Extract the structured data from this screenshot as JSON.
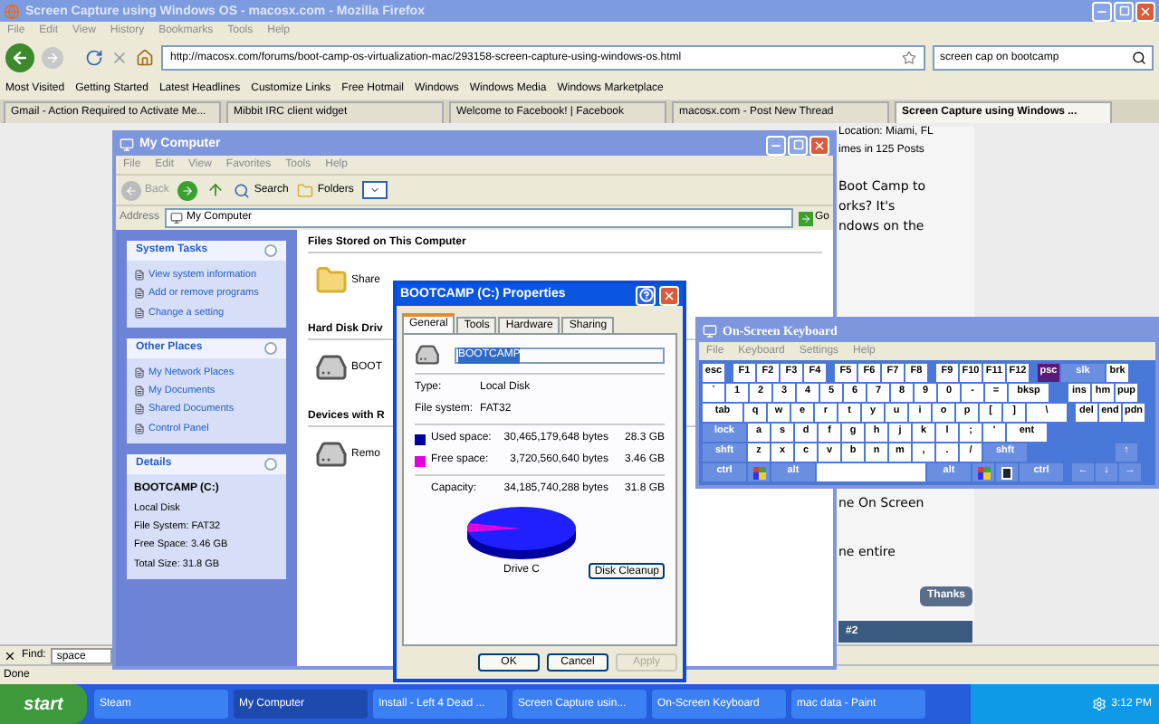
{
  "browser": {
    "title": "Screen Capture using Windows OS - macosx.com - Mozilla Firefox",
    "menu": [
      "File",
      "Edit",
      "View",
      "History",
      "Bookmarks",
      "Tools",
      "Help"
    ],
    "url": "http://macosx.com/forums/boot-camp-os-virtualization-mac/293158-screen-capture-using-windows-os.html",
    "search": "screen cap on bootcamp",
    "bookmarks": [
      "Most Visited",
      "Getting Started",
      "Latest Headlines",
      "Customize Links",
      "Free Hotmail",
      "Windows",
      "Windows Media",
      "Windows Marketplace"
    ],
    "tabs": [
      {
        "label": "Gmail - Action Required to Activate Me...",
        "selected": false
      },
      {
        "label": "Mibbit IRC client widget",
        "selected": false
      },
      {
        "label": "Welcome to Facebook! | Facebook",
        "selected": false
      },
      {
        "label": "macosx.com - Post New Thread",
        "selected": false
      },
      {
        "label": "Screen Capture using Windows ...",
        "selected": true
      }
    ],
    "find_label": "Find:",
    "find_value": "space",
    "status": "Done"
  },
  "page": {
    "lines": [
      "Location: Miami, FL",
      "imes in 125 Posts",
      "Boot Camp to",
      "orks? It's",
      "ndows on the"
    ],
    "lines_lower": [
      "ne On Screen",
      "ne entire"
    ],
    "thanks": "Thanks",
    "post_number": "#2"
  },
  "my_computer": {
    "title": "My Computer",
    "menu": [
      "File",
      "Edit",
      "View",
      "Favorites",
      "Tools",
      "Help"
    ],
    "back": "Back",
    "search": "Search",
    "folders": "Folders",
    "address_label": "Address",
    "address": "My Computer",
    "go": "Go",
    "panels": [
      {
        "title": "System Tasks",
        "items": [
          "View system information",
          "Add or remove programs",
          "Change a setting"
        ]
      },
      {
        "title": "Other Places",
        "items": [
          "My Network Places",
          "My Documents",
          "Shared Documents",
          "Control Panel"
        ]
      }
    ],
    "details": {
      "title": "Details",
      "name": "BOOTCAMP (C:)",
      "lines": [
        "Local Disk",
        "File System: FAT32",
        "Free Space: 3.46 GB",
        "Total Size: 31.8 GB"
      ]
    },
    "groups": [
      {
        "heading": "Files Stored on This Computer",
        "kind": "folder",
        "items": [
          "Share"
        ]
      },
      {
        "heading": "Hard Disk Driv",
        "kind": "drive",
        "items": [
          "BOOT"
        ]
      },
      {
        "heading": "Devices with R",
        "kind": "drive",
        "items": [
          "Remo"
        ]
      }
    ]
  },
  "properties": {
    "title": "BOOTCAMP (C:) Properties",
    "tabs": [
      {
        "label": "General",
        "selected": true
      },
      {
        "label": "Tools",
        "selected": false
      },
      {
        "label": "Hardware",
        "selected": false
      },
      {
        "label": "Sharing",
        "selected": false
      }
    ],
    "name": "BOOTCAMP",
    "info": [
      {
        "label": "Type:",
        "value": "Local Disk"
      },
      {
        "label": "File system:",
        "value": "FAT32"
      }
    ],
    "usage": [
      {
        "label": "Used space:",
        "bytes": "30,465,179,648 bytes",
        "size": "28.3 GB",
        "color": "#0000a0"
      },
      {
        "label": "Free space:",
        "bytes": "3,720,560,640 bytes",
        "size": "3.46 GB",
        "color": "#e000e0"
      }
    ],
    "capacity": {
      "label": "Capacity:",
      "bytes": "34,185,740,288 bytes",
      "size": "31.8 GB"
    },
    "drive_label": "Drive C",
    "cleanup": "Disk Cleanup",
    "buttons": [
      {
        "label": "OK",
        "disabled": false
      },
      {
        "label": "Cancel",
        "disabled": false
      },
      {
        "label": "Apply",
        "disabled": true
      }
    ]
  },
  "keyboard": {
    "title": "On-Screen Keyboard",
    "menu": [
      "File",
      "Keyboard",
      "Settings",
      "Help"
    ],
    "rows": [
      {
        "groups": [
          {
            "keys": [
              {
                "label": "esc",
                "kind": "key",
                "selected": false
              }
            ]
          },
          {
            "keys": [
              {
                "label": "F1",
                "kind": "key",
                "selected": false
              },
              {
                "label": "F2",
                "kind": "key",
                "selected": false
              },
              {
                "label": "F3",
                "kind": "key",
                "selected": false
              },
              {
                "label": "F4",
                "kind": "key",
                "selected": false
              }
            ]
          },
          {
            "keys": [
              {
                "label": "F5",
                "kind": "key",
                "selected": false
              },
              {
                "label": "F6",
                "kind": "key",
                "selected": false
              },
              {
                "label": "F7",
                "kind": "key",
                "selected": false
              },
              {
                "label": "F8",
                "kind": "key",
                "selected": false
              }
            ]
          },
          {
            "keys": [
              {
                "label": "F9",
                "kind": "key",
                "selected": false
              },
              {
                "label": "F10",
                "kind": "key",
                "selected": false
              },
              {
                "label": "F11",
                "kind": "key",
                "selected": false
              },
              {
                "label": "F12",
                "kind": "key",
                "selected": false
              }
            ]
          },
          {
            "keys": [
              {
                "label": "psc",
                "kind": "key",
                "selected": true
              },
              {
                "label": "slk",
                "kind": "mod",
                "selected": false
              },
              {
                "label": "brk",
                "kind": "key",
                "selected": false
              }
            ]
          }
        ]
      },
      {
        "groups": [
          {
            "keys": [
              {
                "label": "`",
                "kind": "key",
                "selected": false
              },
              {
                "label": "1",
                "kind": "key",
                "selected": false
              },
              {
                "label": "2",
                "kind": "key",
                "selected": false
              },
              {
                "label": "3",
                "kind": "key",
                "selected": false
              },
              {
                "label": "4",
                "kind": "key",
                "selected": false
              },
              {
                "label": "5",
                "kind": "key",
                "selected": false
              },
              {
                "label": "6",
                "kind": "key",
                "selected": false
              },
              {
                "label": "7",
                "kind": "key",
                "selected": false
              },
              {
                "label": "8",
                "kind": "key",
                "selected": false
              },
              {
                "label": "9",
                "kind": "key",
                "selected": false
              },
              {
                "label": "0",
                "kind": "key",
                "selected": false
              },
              {
                "label": "-",
                "kind": "key",
                "selected": false
              },
              {
                "label": "=",
                "kind": "key",
                "selected": false
              },
              {
                "label": "bksp",
                "kind": "wide",
                "selected": false
              }
            ]
          },
          {
            "keys": [
              {
                "label": "ins",
                "kind": "key",
                "selected": false
              },
              {
                "label": "hm",
                "kind": "key",
                "selected": false
              },
              {
                "label": "pup",
                "kind": "key",
                "selected": false
              }
            ]
          }
        ]
      },
      {
        "groups": [
          {
            "keys": [
              {
                "label": "tab",
                "kind": "wide",
                "selected": false
              },
              {
                "label": "q",
                "kind": "key",
                "selected": false
              },
              {
                "label": "w",
                "kind": "key",
                "selected": false
              },
              {
                "label": "e",
                "kind": "key",
                "selected": false
              },
              {
                "label": "r",
                "kind": "key",
                "selected": false
              },
              {
                "label": "t",
                "kind": "key",
                "selected": false
              },
              {
                "label": "y",
                "kind": "key",
                "selected": false
              },
              {
                "label": "u",
                "kind": "key",
                "selected": false
              },
              {
                "label": "i",
                "kind": "key",
                "selected": false
              },
              {
                "label": "o",
                "kind": "key",
                "selected": false
              },
              {
                "label": "p",
                "kind": "key",
                "selected": false
              },
              {
                "label": "[",
                "kind": "key",
                "selected": false
              },
              {
                "label": "]",
                "kind": "key",
                "selected": false
              },
              {
                "label": "\\",
                "kind": "wide",
                "selected": false
              }
            ]
          },
          {
            "keys": [
              {
                "label": "del",
                "kind": "key",
                "selected": false
              },
              {
                "label": "end",
                "kind": "key",
                "selected": false
              },
              {
                "label": "pdn",
                "kind": "key",
                "selected": false
              }
            ]
          }
        ]
      },
      {
        "groups": [
          {
            "keys": [
              {
                "label": "lock",
                "kind": "mod",
                "selected": false
              },
              {
                "label": "a",
                "kind": "key",
                "selected": false
              },
              {
                "label": "s",
                "kind": "key",
                "selected": false
              },
              {
                "label": "d",
                "kind": "key",
                "selected": false
              },
              {
                "label": "f",
                "kind": "key",
                "selected": false
              },
              {
                "label": "g",
                "kind": "key",
                "selected": false
              },
              {
                "label": "h",
                "kind": "key",
                "selected": false
              },
              {
                "label": "j",
                "kind": "key",
                "selected": false
              },
              {
                "label": "k",
                "kind": "key",
                "selected": false
              },
              {
                "label": "l",
                "kind": "key",
                "selected": false
              },
              {
                "label": ";",
                "kind": "key",
                "selected": false
              },
              {
                "label": "'",
                "kind": "key",
                "selected": false
              },
              {
                "label": "ent",
                "kind": "wide",
                "selected": false
              }
            ]
          }
        ]
      },
      {
        "groups": [
          {
            "keys": [
              {
                "label": "shft",
                "kind": "mod",
                "selected": false
              },
              {
                "label": "z",
                "kind": "key",
                "selected": false
              },
              {
                "label": "x",
                "kind": "key",
                "selected": false
              },
              {
                "label": "c",
                "kind": "key",
                "selected": false
              },
              {
                "label": "v",
                "kind": "key",
                "selected": false
              },
              {
                "label": "b",
                "kind": "key",
                "selected": false
              },
              {
                "label": "n",
                "kind": "key",
                "selected": false
              },
              {
                "label": "m",
                "kind": "key",
                "selected": false
              },
              {
                "label": ",",
                "kind": "key",
                "selected": false
              },
              {
                "label": ".",
                "kind": "key",
                "selected": false
              },
              {
                "label": "/",
                "kind": "key",
                "selected": false
              },
              {
                "label": "shft",
                "kind": "mod",
                "selected": false
              }
            ]
          },
          {
            "keys": [
              {
                "label": "↑",
                "kind": "arrow",
                "selected": false
              }
            ]
          }
        ]
      },
      {
        "groups": [
          {
            "keys": [
              {
                "label": "ctrl",
                "kind": "mod",
                "selected": false
              },
              {
                "kind": "logo",
                "selected": false
              },
              {
                "label": "alt",
                "kind": "mod",
                "selected": false
              },
              {
                "kind": "space",
                "selected": false
              },
              {
                "label": "alt",
                "kind": "mod",
                "selected": false
              },
              {
                "kind": "logo",
                "selected": false
              },
              {
                "kind": "app",
                "selected": false
              },
              {
                "label": "ctrl",
                "kind": "mod",
                "selected": false
              }
            ]
          },
          {
            "keys": [
              {
                "label": "←",
                "kind": "arrow",
                "selected": false
              },
              {
                "label": "↓",
                "kind": "arrow",
                "selected": false
              },
              {
                "label": "→",
                "kind": "arrow",
                "selected": false
              }
            ]
          }
        ]
      }
    ]
  },
  "taskbar": {
    "start": "start",
    "items": [
      {
        "label": "Steam",
        "selected": false
      },
      {
        "label": "My Computer",
        "selected": true
      },
      {
        "label": "Install - Left 4 Dead ...",
        "selected": false
      },
      {
        "label": "Screen Capture usin...",
        "selected": false
      },
      {
        "label": "On-Screen Keyboard",
        "selected": false
      },
      {
        "label": "mac data - Paint",
        "selected": false
      }
    ],
    "clock": "3:12 PM"
  }
}
